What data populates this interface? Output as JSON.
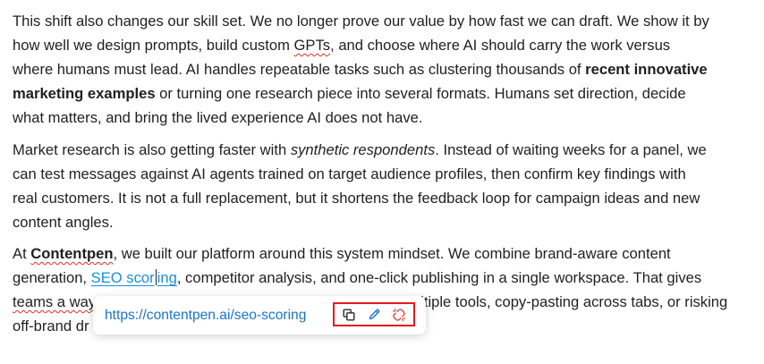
{
  "paragraphs": {
    "p1": {
      "l1": "This shift also changes our skill set. We no longer prove our value by how fast we can draft. We show it by",
      "l2_a": "how well we design prompts, build custom ",
      "l2_spell": "GPTs",
      "l2_b": ", and choose where AI should carry the work versus",
      "l3_a": "where humans must lead. AI handles repeatable tasks such as clustering thousands of ",
      "l3_bold": "recent innovative",
      "l4_bold": "marketing examples",
      "l4_b": " or turning one research piece into several formats. Humans set direction, decide",
      "l5": "what matters, and bring the lived experience AI does not have."
    },
    "p2": {
      "l1_a": "Market research is also getting faster with ",
      "l1_ital": "synthetic respondents",
      "l1_b": ". Instead of waiting weeks for a panel, we",
      "l2": "can test messages against AI agents trained on target audience profiles, then confirm key findings with",
      "l3": "real customers. It is not a full replacement, but it shortens the feedback loop for campaign ideas and new",
      "l4": "content angles."
    },
    "p3": {
      "l1_a": "At ",
      "l1_brand": "Contentpen",
      "l1_b": ", we built our platform around this system mindset. We combine brand-aware content",
      "l2_a": "generation, ",
      "l2_link_a": "SEO scor",
      "l2_link_b": "ing",
      "l2_b": ", competitor analysis, and one-click publishing in a single workspace. That gives",
      "l3_a": "teams a way",
      "l3_b": "ltiple tools, copy-pasting across tabs, or risking",
      "l4_a": "off-brand dr"
    }
  },
  "link_popup": {
    "url": "https://contentpen.ai/seo-scoring",
    "icons": {
      "copy": "copy-icon",
      "edit": "pencil-icon",
      "unlink": "unlink-icon"
    }
  },
  "colors": {
    "link": "#1a8fd6",
    "popup_url": "#1a73c8",
    "highlight_border": "#e31b1b",
    "spell_underline": "#d93025"
  }
}
